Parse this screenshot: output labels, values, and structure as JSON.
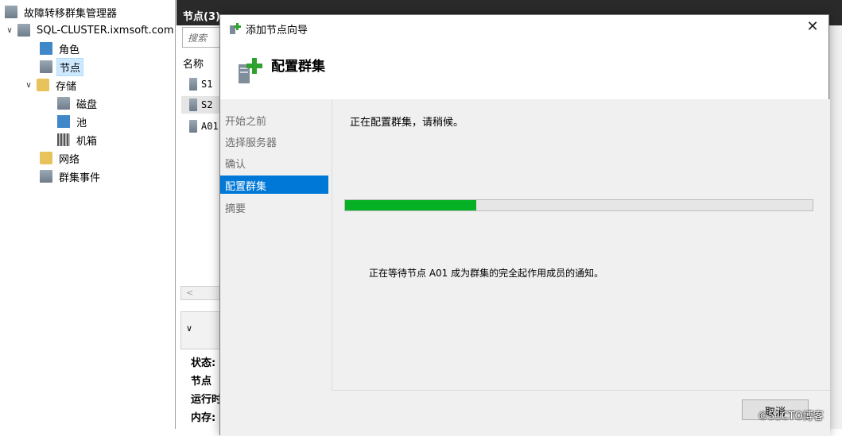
{
  "tree": {
    "root_label": "故障转移群集管理器",
    "cluster_label": "SQL-CLUSTER.ixmsoft.com",
    "items": [
      {
        "label": "角色"
      },
      {
        "label": "节点"
      },
      {
        "label": "存储"
      },
      {
        "label": "磁盘"
      },
      {
        "label": "池"
      },
      {
        "label": "机箱"
      },
      {
        "label": "网络"
      },
      {
        "label": "群集事件"
      }
    ]
  },
  "middle": {
    "header": "节点(3)",
    "search_placeholder": "搜索",
    "column_name": "名称",
    "rows": [
      "S1",
      "S2",
      "A01"
    ],
    "details": [
      "状态:",
      "节点",
      "运行时",
      "内存:"
    ]
  },
  "dialog": {
    "title": "添加节点向导",
    "heading": "配置群集",
    "steps": [
      "开始之前",
      "选择服务器",
      "确认",
      "配置群集",
      "摘要"
    ],
    "current_step": 3,
    "status_message": "正在配置群集，请稍候。",
    "progress": 0.28,
    "wait_message": "正在等待节点 A01 成为群集的完全起作用成员的通知。",
    "cancel_label": "取消"
  },
  "watermark": "©51CTO博客",
  "colors": {
    "accent": "#0078d7",
    "progress": "#06b025",
    "header_bg": "#2a2a2a"
  }
}
